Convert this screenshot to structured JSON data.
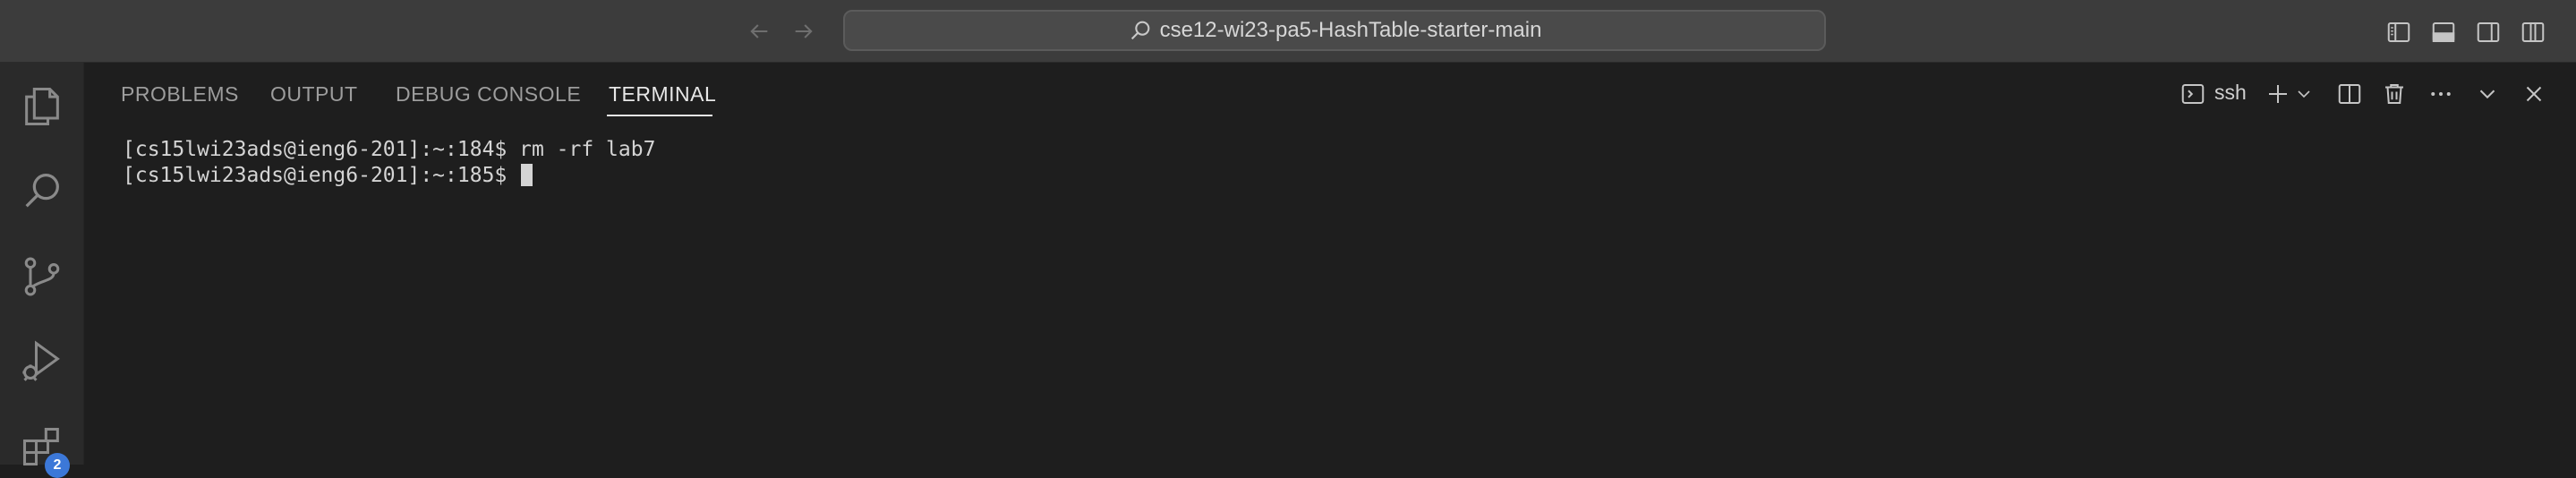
{
  "window": {
    "search_title": "cse12-wi23-pa5-HashTable-starter-main"
  },
  "panel": {
    "tabs": [
      {
        "label": "PROBLEMS"
      },
      {
        "label": "OUTPUT"
      },
      {
        "label": "DEBUG CONSOLE"
      },
      {
        "label": "TERMINAL",
        "active": true
      }
    ],
    "terminal_profile": "ssh"
  },
  "terminal": {
    "lines": [
      {
        "prompt": "[cs15lwi23ads@ieng6-201]:~:184$ ",
        "command": "rm -rf lab7"
      },
      {
        "prompt": "[cs15lwi23ads@ieng6-201]:~:185$ ",
        "command": ""
      }
    ]
  },
  "activity": {
    "extensions_badge": "2"
  },
  "colors": {
    "editor_bg": "#1e1e1e",
    "titlebar_bg": "#3c3c3c",
    "activitybar_bg": "#2a2a2a",
    "badge": "#3c78d8"
  },
  "icons": {
    "nav": [
      "arrow-left-icon",
      "arrow-right-icon"
    ],
    "search": "search-icon",
    "layout": [
      "toggle-primary-sidebar-icon",
      "toggle-panel-icon",
      "toggle-secondary-sidebar-icon",
      "customize-layout-icon"
    ],
    "activity": [
      "explorer-icon",
      "search-icon",
      "source-control-icon",
      "run-debug-icon",
      "extensions-icon"
    ],
    "panel_actions": [
      "terminal-icon",
      "new-terminal-icon",
      "chevron-down-icon",
      "split-terminal-icon",
      "trash-icon",
      "more-icon",
      "collapse-icon",
      "close-icon"
    ]
  }
}
